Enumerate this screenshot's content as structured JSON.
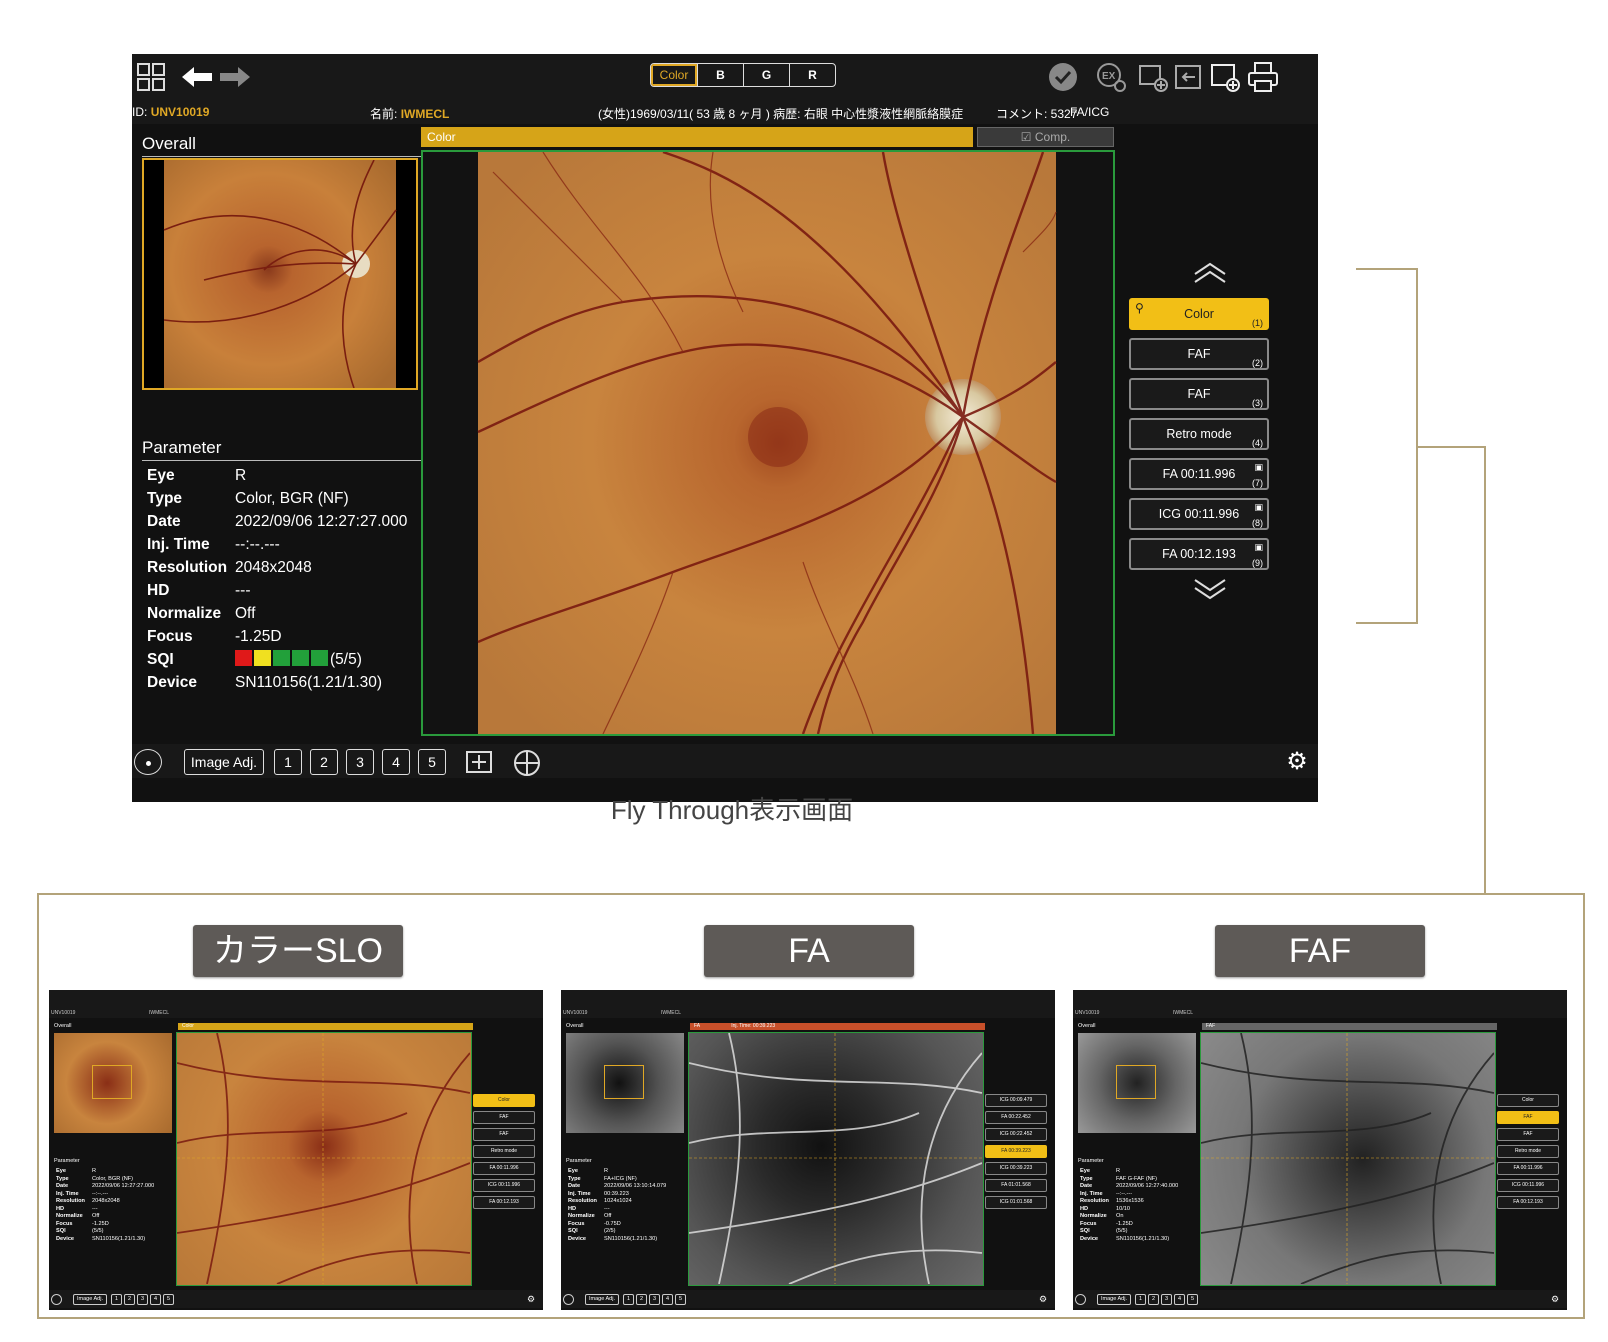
{
  "colors": {
    "accent": "#e0a825",
    "green_frame": "#2a9a3c",
    "bracket": "#b3a37a",
    "label_bg": "#5e5a57"
  },
  "toolbar": {
    "channel_buttons": [
      "Color",
      "B",
      "G",
      "R"
    ],
    "active_channel": "Color",
    "icons": [
      "patient-list-icon",
      "back-arrow-icon",
      "forward-arrow-icon",
      "check-icon",
      "export-icon",
      "add-image-icon",
      "import-image-icon",
      "new-exam-icon",
      "print-icon"
    ]
  },
  "patient": {
    "id_label": "ID:",
    "id_value": "UNV10019",
    "name_label": "名前:",
    "name_value": "IWMECL",
    "details": "(女性)1969/03/11( 53 歳 8 ヶ月 ) 病歴: 右眼 中心性漿液性網脈絡膜症",
    "comment": "コメント: 5327",
    "study": "FA/ICG"
  },
  "overall": {
    "title": "Overall"
  },
  "parameter": {
    "title": "Parameter",
    "rows": [
      {
        "label": "Eye",
        "value": "R"
      },
      {
        "label": "Type",
        "value": "Color, BGR (NF)"
      },
      {
        "label": "Date",
        "value": "2022/09/06 12:27:27.000"
      },
      {
        "label": "Inj. Time",
        "value": "--:--.---"
      },
      {
        "label": "Resolution",
        "value": "2048x2048"
      },
      {
        "label": "HD",
        "value": "---"
      },
      {
        "label": "Normalize",
        "value": "Off"
      },
      {
        "label": "Focus",
        "value": "-1.25D"
      },
      {
        "label": "SQI",
        "value": "(5/5)"
      },
      {
        "label": "Device",
        "value": "SN110156(1.21/1.30)"
      }
    ],
    "sqi_colors": [
      "#e01919",
      "#f0e020",
      "#22a03a",
      "#22a03a",
      "#22a03a"
    ]
  },
  "image_tab": {
    "label": "Color",
    "comp_label": "Comp."
  },
  "sidebar": {
    "items": [
      {
        "label": "Color",
        "num": "(1)",
        "active": true,
        "pin": true
      },
      {
        "label": "FAF",
        "num": "(2)",
        "active": false
      },
      {
        "label": "FAF",
        "num": "(3)",
        "active": false
      },
      {
        "label": "Retro mode",
        "num": "(4)",
        "active": false
      },
      {
        "label": "FA 00:11.996",
        "num": "(7)",
        "active": false,
        "bookmark": true
      },
      {
        "label": "ICG 00:11.996",
        "num": "(8)",
        "active": false,
        "bookmark": true
      },
      {
        "label": "FA 00:12.193",
        "num": "(9)",
        "active": false,
        "bookmark": true
      }
    ]
  },
  "bottombar": {
    "image_adj_label": "Image Adj.",
    "layouts": [
      "1",
      "2",
      "3",
      "4",
      "5"
    ],
    "active_layout": "3"
  },
  "caption": "Fly Through表示画面",
  "examples": [
    {
      "label": "カラーSLO",
      "tab": "Color",
      "params": [
        [
          "Eye",
          "R"
        ],
        [
          "Type",
          "Color, BGR (NF)"
        ],
        [
          "Date",
          "2022/09/06 12:27:27.000"
        ],
        [
          "Inj. Time",
          "--:--.---"
        ],
        [
          "Resolution",
          "2048x2048"
        ],
        [
          "HD",
          "---"
        ],
        [
          "Normalize",
          "Off"
        ],
        [
          "Focus",
          "-1.25D"
        ],
        [
          "SQI",
          "(5/5)"
        ],
        [
          "Device",
          "SN110156(1.21/1.30)"
        ]
      ],
      "side": [
        "Color",
        "FAF",
        "FAF",
        "Retro mode",
        "FA 00:11.996",
        "ICG 00:11.996",
        "FA 00:12.193"
      ],
      "active_side": 0
    },
    {
      "label": "FA",
      "tab": "FA",
      "tab_extra": "Inj. Time: 00:39.223",
      "params": [
        [
          "Eye",
          "R"
        ],
        [
          "Type",
          "FA+ICG (NF)"
        ],
        [
          "Date",
          "2022/09/06 13:10:14.079"
        ],
        [
          "Inj. Time",
          "00:39.223"
        ],
        [
          "Resolution",
          "1024x1024"
        ],
        [
          "HD",
          "---"
        ],
        [
          "Normalize",
          "Off"
        ],
        [
          "Focus",
          "-0.75D"
        ],
        [
          "SQI",
          "(2/5)"
        ],
        [
          "Device",
          "SN110156(1.21/1.30)"
        ]
      ],
      "side": [
        "ICG 00:09.479",
        "FA 00:22.452",
        "ICG 00:22.452",
        "FA 00:39.223",
        "ICG 00:39.223",
        "FA 01:01.568",
        "ICG 01:01.568"
      ],
      "active_side": 3
    },
    {
      "label": "FAF",
      "tab": "FAF",
      "params": [
        [
          "Eye",
          "R"
        ],
        [
          "Type",
          "FAF G-FAF (NF)"
        ],
        [
          "Date",
          "2022/09/06 12:27:40.000"
        ],
        [
          "Inj. Time",
          "--:--.---"
        ],
        [
          "Resolution",
          "1536x1536"
        ],
        [
          "HD",
          "10/10"
        ],
        [
          "Normalize",
          "On"
        ],
        [
          "Focus",
          "-1.25D"
        ],
        [
          "SQI",
          "(5/5)"
        ],
        [
          "Device",
          "SN110156(1.21/1.30)"
        ]
      ],
      "side": [
        "Color",
        "FAF",
        "FAF",
        "Retro mode",
        "FA 00:11.996",
        "ICG 00:11.996",
        "FA 00:12.193"
      ],
      "active_side": 1
    }
  ]
}
